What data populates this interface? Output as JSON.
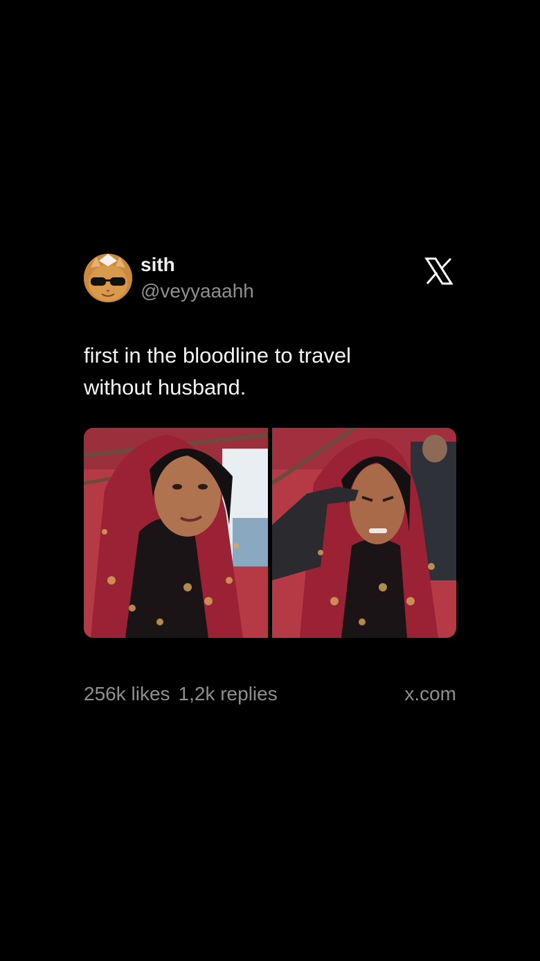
{
  "author": {
    "display_name": "sith",
    "handle": "@veyyaaahh",
    "avatar_icon": "cat-with-sunglasses-avatar"
  },
  "platform_icon": "x-logo-icon",
  "tweet": {
    "text_line_1": "first in the bloodline to travel",
    "text_line_2": "without husband."
  },
  "media": [
    {
      "description_icon": "photo-selfie-smiling"
    },
    {
      "description_icon": "photo-selfie-grimace"
    }
  ],
  "stats": {
    "likes": "256k likes",
    "replies": "1,2k replies"
  },
  "footer": {
    "site": "x.com"
  },
  "colors": {
    "background": "#000000",
    "primary_text": "#f5f5f5",
    "secondary_text": "#8f8f8f",
    "shawl": "#8e1f33"
  }
}
